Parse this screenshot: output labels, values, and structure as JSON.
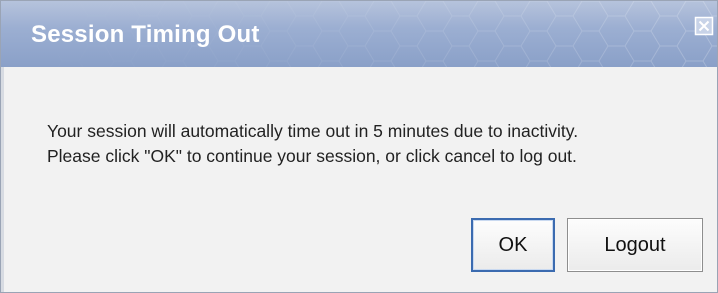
{
  "dialog": {
    "title": "Session Timing Out",
    "close_icon": "close-icon",
    "message_lines": [
      "Your session will automatically time out in 5 minutes due to inactivity.",
      "Please click \"OK\" to continue your session, or click cancel to log out."
    ],
    "buttons": {
      "ok_label": "OK",
      "logout_label": "Logout"
    }
  },
  "colors": {
    "titlebar": "#9cafd2",
    "title_text": "#ffffff",
    "body_background": "#f2f2f2",
    "focus_border": "#3b6bb0"
  }
}
